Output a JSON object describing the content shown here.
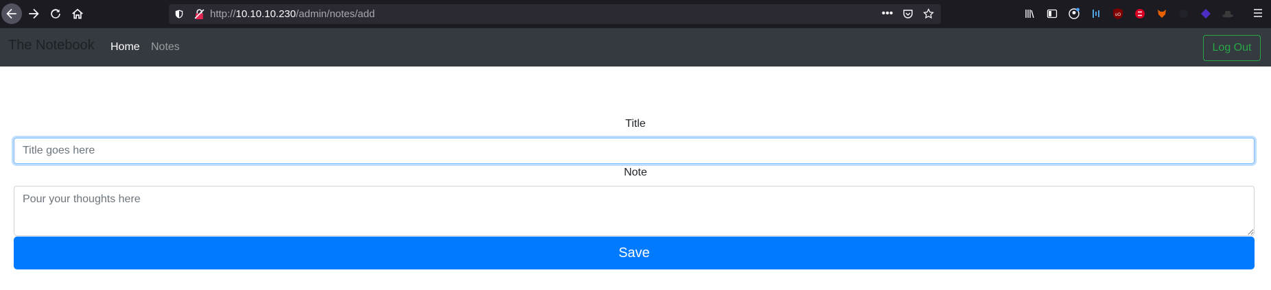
{
  "browser": {
    "url_prefix": "http://",
    "url_host": "10.10.10.230",
    "url_path": "/admin/notes/add",
    "url_actions_more": "•••"
  },
  "navbar": {
    "brand": "The Notebook",
    "links": [
      "Home",
      "Notes"
    ],
    "logout_label": "Log Out"
  },
  "form": {
    "title_label": "Title",
    "title_placeholder": "Title goes here",
    "title_value": "",
    "note_label": "Note",
    "note_placeholder": "Pour your thoughts here",
    "note_value": "",
    "save_label": "Save"
  },
  "colors": {
    "navbar_bg": "#343a40",
    "save_button": "#007bff",
    "logout_outline": "#28a745",
    "browser_chrome": "#1c1b22"
  }
}
